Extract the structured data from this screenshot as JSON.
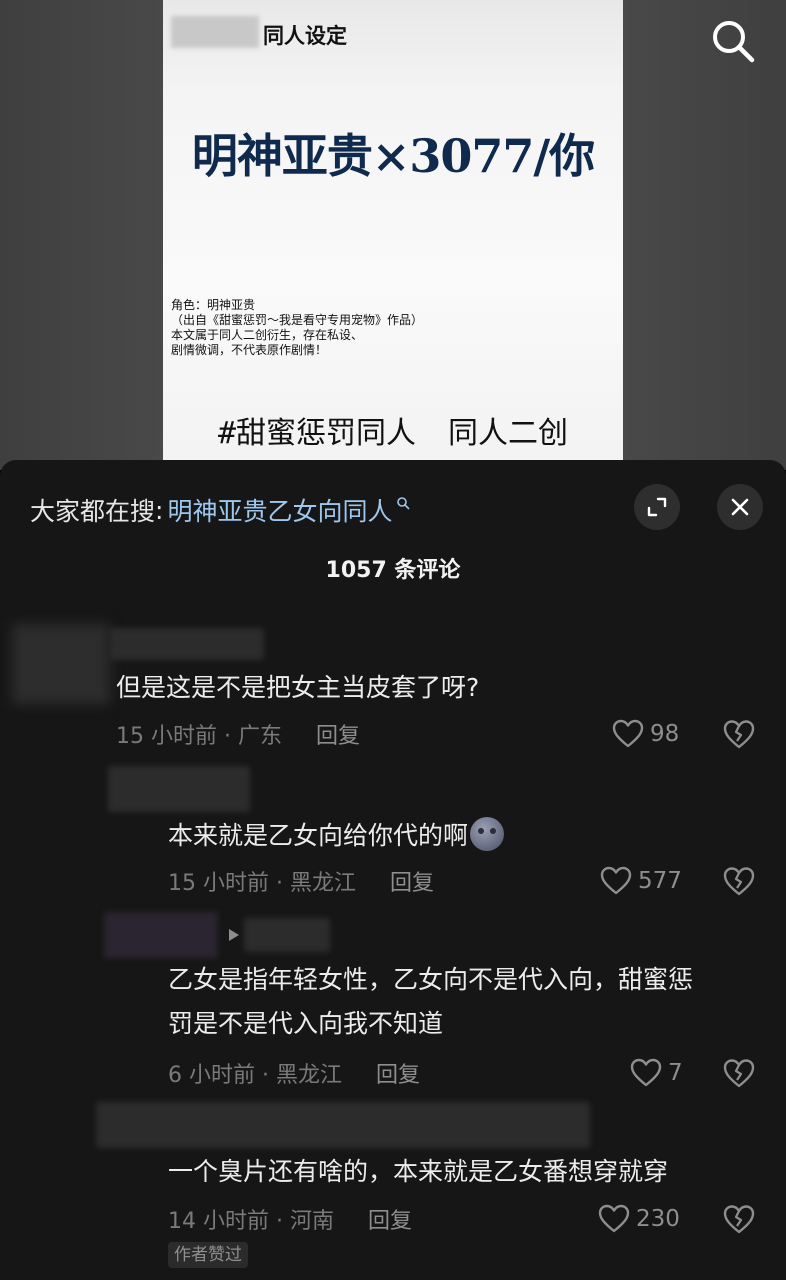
{
  "poster": {
    "tag": "同人设定",
    "headline": "明神亚贵×3077/你",
    "description": "角色：明神亚贵\n（出自《甜蜜惩罚～我是看守专用宠物》作品）\n本文属于同人二创衍生，存在私设、\n剧情微调，不代表原作剧情！",
    "hashtags": "#甜蜜惩罚同人 同人二创"
  },
  "panel": {
    "search_prefix": "大家都在搜",
    "search_colon": ":",
    "search_query": "明神亚贵乙女向同人",
    "comment_count": "1057 条评论"
  },
  "comments": [
    {
      "text": "但是这是不是把女主当皮套了呀?",
      "time_loc": "15 小时前 · 广东",
      "reply": "回复",
      "likes": "98"
    },
    {
      "text": "本来就是乙女向给你代的啊",
      "time_loc": "15 小时前 · 黑龙江",
      "reply": "回复",
      "likes": "577"
    },
    {
      "text_line1": "乙女是指年轻女性，乙女向不是代入向，甜蜜惩",
      "text_line2": "罚是不是代入向我不知道",
      "time_loc": "6 小时前 · 黑龙江",
      "reply": "回复",
      "likes": "7"
    },
    {
      "text": "一个臭片还有啥的，本来就是乙女番想穿就穿",
      "time_loc": "14 小时前 · 河南",
      "reply": "回复",
      "likes": "230",
      "badge": "作者赞过"
    }
  ],
  "icons": {
    "search": "search-icon",
    "expand": "expand-icon",
    "close": "close-icon",
    "like": "heart-icon",
    "dislike": "broken-heart-icon",
    "emoji": "moon-face-emoji"
  }
}
